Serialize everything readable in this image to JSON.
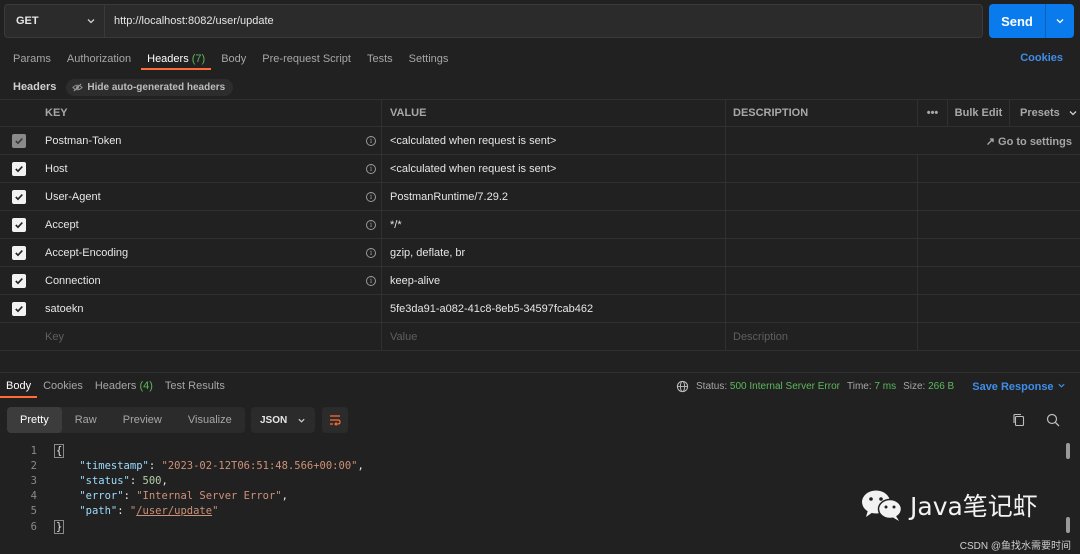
{
  "request": {
    "method": "GET",
    "url": "http://localhost:8082/user/update",
    "send_label": "Send"
  },
  "req_tabs": [
    {
      "label": "Params"
    },
    {
      "label": "Authorization"
    },
    {
      "label": "Headers",
      "count": "(7)"
    },
    {
      "label": "Body"
    },
    {
      "label": "Pre-request Script"
    },
    {
      "label": "Tests"
    },
    {
      "label": "Settings"
    }
  ],
  "cookies_label": "Cookies",
  "headers_sub": {
    "label": "Headers",
    "hide_btn": "Hide auto-generated headers"
  },
  "table": {
    "columns": {
      "key": "KEY",
      "value": "VALUE",
      "description": "DESCRIPTION"
    },
    "bulk_edit": "Bulk Edit",
    "presets": "Presets",
    "goto_settings": "Go to settings",
    "rows": [
      {
        "key": "Postman-Token",
        "value": "<calculated when request is sent>"
      },
      {
        "key": "Host",
        "value": "<calculated when request is sent>"
      },
      {
        "key": "User-Agent",
        "value": "PostmanRuntime/7.29.2"
      },
      {
        "key": "Accept",
        "value": "*/*"
      },
      {
        "key": "Accept-Encoding",
        "value": "gzip, deflate, br"
      },
      {
        "key": "Connection",
        "value": "keep-alive"
      },
      {
        "key": "satoekn",
        "value": "5fe3da91-a082-41c8-8eb5-34597fcab462"
      }
    ],
    "placeholders": {
      "key": "Key",
      "value": "Value",
      "description": "Description"
    }
  },
  "response": {
    "tabs": [
      {
        "label": "Body"
      },
      {
        "label": "Cookies"
      },
      {
        "label": "Headers",
        "count": "(4)"
      },
      {
        "label": "Test Results"
      }
    ],
    "status_label": "Status:",
    "status_value": "500 Internal Server Error",
    "time_label": "Time:",
    "time_value": "7 ms",
    "size_label": "Size:",
    "size_value": "266 B",
    "save_label": "Save Response",
    "formats": [
      "Pretty",
      "Raw",
      "Preview",
      "Visualize"
    ],
    "lang": "JSON",
    "body_lines": {
      "l1": "{",
      "timestamp_key": "\"timestamp\"",
      "timestamp_val": "\"2023-02-12T06:51:48.566+00:00\"",
      "status_key": "\"status\"",
      "status_val": "500",
      "error_key": "\"error\"",
      "error_val": "\"Internal Server Error\"",
      "path_key": "\"path\"",
      "path_q1": "\"",
      "path_val": "/user/update",
      "path_q2": "\"",
      "l6": "}"
    },
    "line_numbers": [
      "1",
      "2",
      "3",
      "4",
      "5",
      "6"
    ]
  },
  "watermark": {
    "text": "Java笔记虾",
    "csdn": "CSDN @鱼找水需要时间"
  }
}
